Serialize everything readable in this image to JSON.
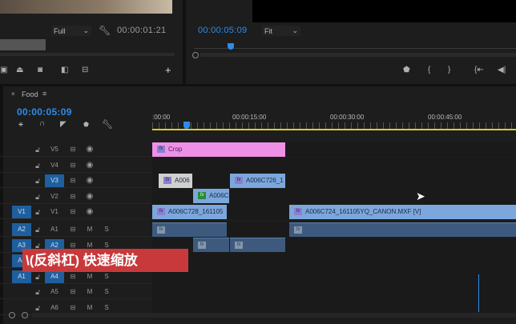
{
  "source_monitor": {
    "quality": "Full",
    "timecode": "00:00:01:21"
  },
  "program_monitor": {
    "timecode": "00:00:05:09",
    "zoom": "Fit"
  },
  "timeline": {
    "sequence_name": "Food",
    "timecode": "00:00:05:09",
    "ruler": [
      ":00:00",
      "00:00:15:00",
      "00:00:30:00",
      "00:00:45:00"
    ],
    "video_tracks": [
      {
        "name": "V5",
        "source": "",
        "target": false
      },
      {
        "name": "V4",
        "source": "",
        "target": false
      },
      {
        "name": "V3",
        "source": "",
        "target": true
      },
      {
        "name": "V2",
        "source": "",
        "target": false
      },
      {
        "name": "V1",
        "source": "V1",
        "target": false
      }
    ],
    "audio_tracks": [
      {
        "name": "A1",
        "source": "A2",
        "target": false
      },
      {
        "name": "A2",
        "source": "A3",
        "target": true
      },
      {
        "name": "A3",
        "source": "A4",
        "target": false
      },
      {
        "name": "A4",
        "source": "A1",
        "target": true
      },
      {
        "name": "A5",
        "source": "",
        "target": false
      },
      {
        "name": "A6",
        "source": "",
        "target": false
      }
    ],
    "mute_label": "M",
    "solo_label": "S",
    "fx_label": "fx",
    "clips": {
      "crop": "Crop",
      "v3a": "A006",
      "v3b": "A006C726_1",
      "v2": "A006C",
      "v1a": "A006C728_161105",
      "v1b": "A006C724_161105YQ_CANON.MXF [V]"
    }
  },
  "overlay_caption": "\\(反斜杠) 快速缩放",
  "colors": {
    "accent": "#2d8ceb",
    "crop_clip": "#ee90e6",
    "video_clip": "#7ca7dc",
    "audio_clip": "#3d5a7e",
    "caption_bg": "#c8393b",
    "work_area": "#d8d020"
  }
}
